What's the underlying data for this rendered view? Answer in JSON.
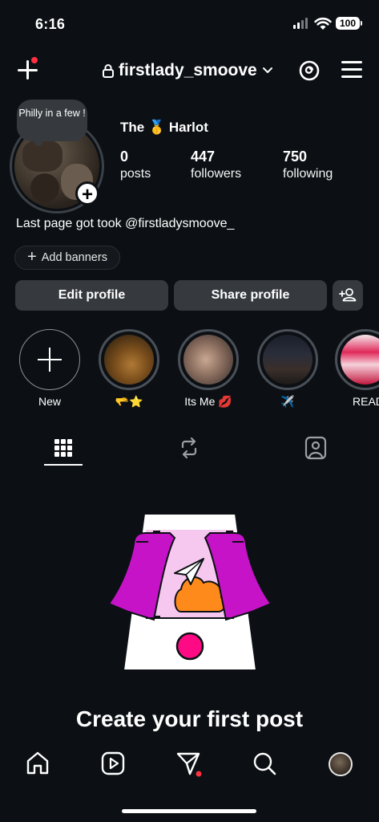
{
  "status_bar": {
    "time": "6:16",
    "battery": "100"
  },
  "header": {
    "username": "firstlady_smoove"
  },
  "profile": {
    "note": "Philly in a few !",
    "display_name": "The 🥇 Harlot",
    "stats": [
      {
        "value": "0",
        "label": "posts"
      },
      {
        "value": "447",
        "label": "followers"
      },
      {
        "value": "750",
        "label": "following"
      }
    ],
    "bio": "Last page got took @firstladysmoove_",
    "add_banners": "Add banners"
  },
  "actions": {
    "edit": "Edit profile",
    "share": "Share profile"
  },
  "highlights": [
    {
      "label": "New"
    },
    {
      "label": "🫳⭐"
    },
    {
      "label": "Its Me 💋"
    },
    {
      "label": "✈️"
    },
    {
      "label": "READ"
    }
  ],
  "tabs": [
    "grid-icon",
    "reels-icon",
    "tagged-icon"
  ],
  "empty_state": {
    "title": "Create your first post"
  },
  "colors": {
    "background": "#0c1014",
    "button": "#363a3f",
    "accent_magenta": "#c613c8",
    "accent_orange": "#ff8a1c",
    "badge_red": "#ff3040"
  },
  "bottom_nav": [
    "home-icon",
    "reels-icon",
    "messages-icon",
    "search-icon",
    "profile-avatar"
  ]
}
